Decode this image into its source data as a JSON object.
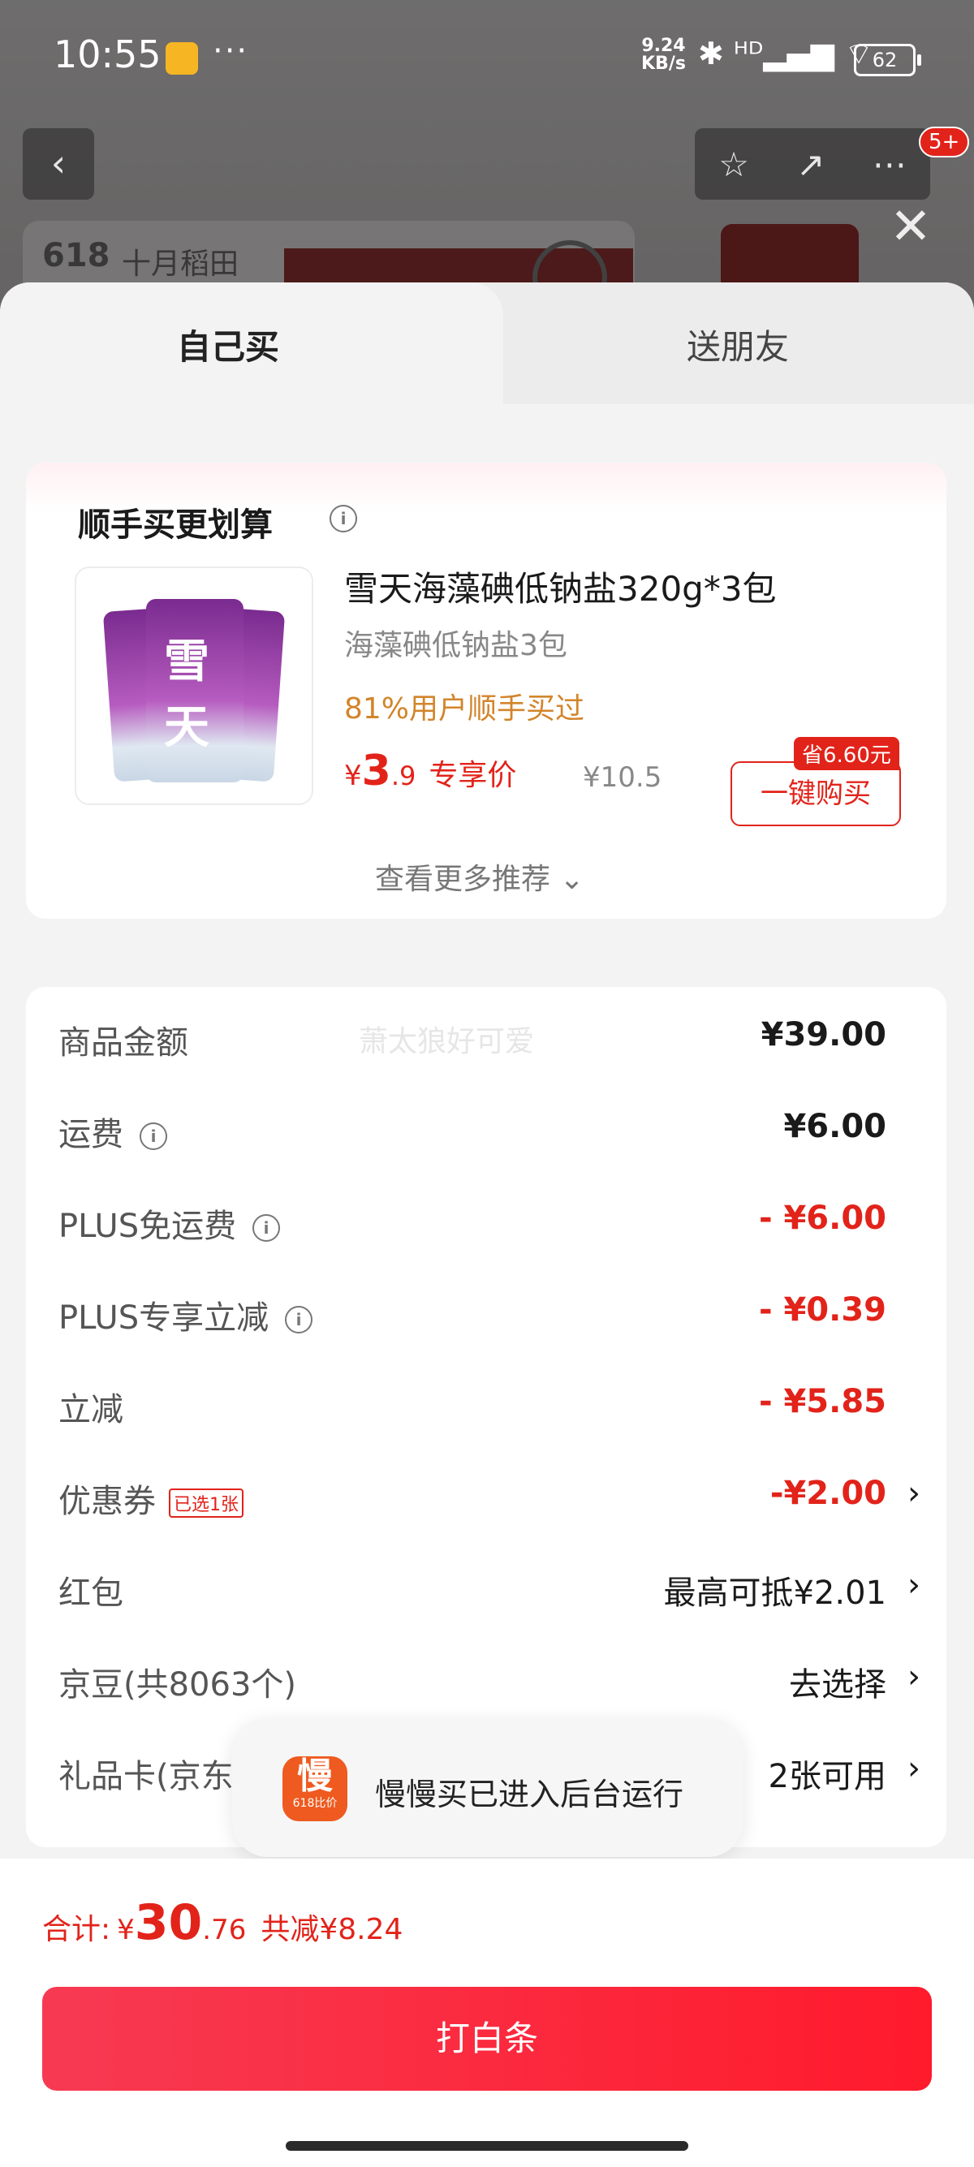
{
  "status_bar": {
    "time": "10:55",
    "dots": "···",
    "net_speed_value": "9.24",
    "net_speed_unit": "KB/s",
    "signal_icons": "✱ ᴴᴰ▂▄▆ ⌔",
    "battery": "62"
  },
  "background": {
    "logo_text": "618",
    "brand_text": "十月稻田",
    "cart_badge": "5+"
  },
  "tabs": {
    "self_buy": "自己买",
    "gift": "送朋友"
  },
  "recommend": {
    "title": "顺手买更划算",
    "pack_text": "雪天",
    "product_name": "雪天海藻碘低钠盐320g*3包",
    "product_sub": "海藻碘低钠盐3包",
    "users_text": "81%用户顺手买过",
    "price_currency": "¥",
    "price_int": "3",
    "price_dec": ".9",
    "price_label": "专享价",
    "orig_price": "¥10.5",
    "save_tag": "省6.60元",
    "buy_button": "一键购买",
    "more_link": "查看更多推荐 ⌄"
  },
  "fees": {
    "watermark": "萧太狼好可爱",
    "rows": [
      {
        "label": "商品金额",
        "value": "¥39.00"
      },
      {
        "label": "运费",
        "value": "¥6.00"
      },
      {
        "label": "PLUS免运费",
        "value": "- ¥6.00"
      },
      {
        "label": "PLUS专享立减",
        "value": "- ¥0.39"
      },
      {
        "label": "立减",
        "value": "- ¥5.85"
      },
      {
        "label": "优惠券",
        "tag": "已选1张",
        "value": "-¥2.00"
      },
      {
        "label": "红包",
        "value": "最高可抵¥2.01"
      },
      {
        "label": "京豆(共8063个)",
        "value": "去选择"
      },
      {
        "label": "礼品卡(京东",
        "value": "2张可用"
      }
    ]
  },
  "toast": {
    "icon_text": "慢",
    "icon_sub": "618比价",
    "message": "慢慢买已进入后台运行"
  },
  "footer": {
    "total_label": "合计:",
    "currency": "¥",
    "total_int": "30",
    "total_dec": ".76",
    "reduce": "共减¥8.24",
    "pay_button": "打白条"
  },
  "colors": {
    "accent": "#e2231a",
    "price_orange": "#d2852b",
    "pay_gradient_start": "#f73a52",
    "pay_gradient_end": "#ff1a2c"
  }
}
